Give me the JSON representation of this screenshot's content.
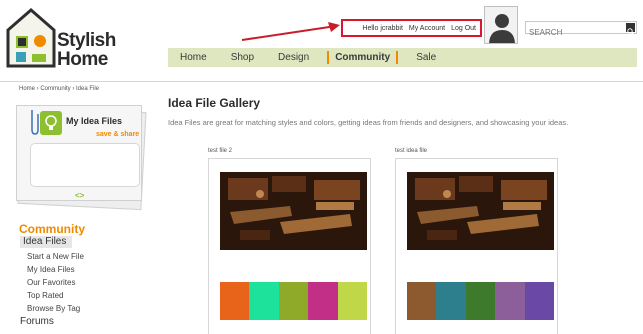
{
  "logo": {
    "line1": "Stylish",
    "line2": "Home"
  },
  "user_links": {
    "greeting": "Hello jcrabbit",
    "account": "My Account",
    "logout": "Log Out"
  },
  "search": {
    "placeholder": "SEARCH"
  },
  "nav": {
    "items": [
      "Home",
      "Shop",
      "Design",
      "Community",
      "Sale"
    ],
    "active": "Community"
  },
  "breadcrumb": "Home › Community › Idea File",
  "widget": {
    "title": "My Idea Files",
    "save": "save & share",
    "arrows": "<>"
  },
  "sidebar": {
    "heading": "Community",
    "active": "Idea Files",
    "sub_items": [
      "Start a New File",
      "My Idea Files",
      "Our Favorites",
      "Top Rated",
      "Browse By Tag"
    ],
    "forums": "Forums"
  },
  "main": {
    "title": "Idea File Gallery",
    "description": "Idea Files are great for matching styles and colors, getting ideas from friends and designers, and showcasing your ideas."
  },
  "files": [
    {
      "label": "test file 2",
      "swatches": [
        "#e8641b",
        "#1de29c",
        "#8faa28",
        "#c12f86",
        "#c0d748"
      ]
    },
    {
      "label": "test idea file",
      "swatches": [
        "#8c5a2e",
        "#2d7f8e",
        "#3e7a2c",
        "#8c5f9a",
        "#6a48a6"
      ]
    }
  ],
  "colors": {
    "accent": "#f08a00",
    "nav_bg": "#dfe7c0",
    "highlight_border": "#d9182d"
  }
}
